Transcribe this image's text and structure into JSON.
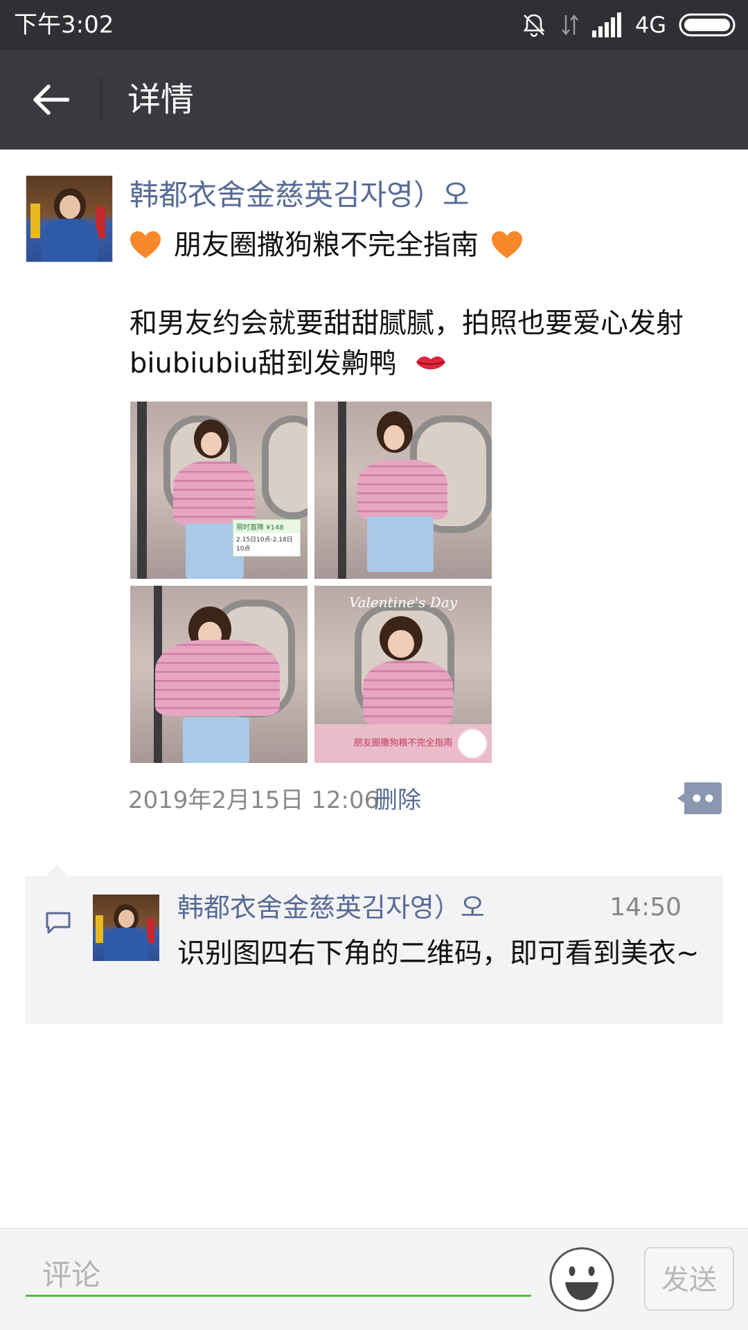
{
  "status_bar": {
    "time": "下午3:02",
    "network": "4G",
    "icons": [
      "mute-icon",
      "data-arrows-icon",
      "signal-icon",
      "battery-icon"
    ]
  },
  "toolbar": {
    "title": "详情",
    "back_icon": "arrow-left-icon"
  },
  "post": {
    "author": "韩都衣舍金慈英김자영）오",
    "subtitle": "朋友圈撒狗粮不完全指南",
    "subtitle_icon": "orange-heart-icon",
    "body_line1": "和男友约会就要甜甜腻腻，拍照也要爱心发射",
    "body_line2": "biubiubiu甜到发齁鸭",
    "body_icon": "lips-icon",
    "photos": [
      {
        "tag_title": "限时直降 ¥148",
        "tag_sub": "2.15日10点-2.18日10点"
      },
      {},
      {},
      {
        "overlay_title": "Valentine's Day",
        "banner": "朋友圈撒狗粮不完全指南"
      }
    ],
    "timestamp": "2019年2月15日 12:06",
    "delete_label": "删除",
    "more_icon": "more-dots-icon"
  },
  "comment": {
    "icon": "comment-icon",
    "author": "韩都衣舍金慈英김자영）오",
    "time": "14:50",
    "text": "识别图四右下角的二维码，即可看到美衣~"
  },
  "input_bar": {
    "placeholder": "评论",
    "value": "",
    "emoji_icon": "smiley-icon",
    "send_label": "发送",
    "accent_color": "#4cbf3c"
  },
  "colors": {
    "toolbar": "#393a3f",
    "statusbar": "#2e3034",
    "link": "#576b95"
  }
}
